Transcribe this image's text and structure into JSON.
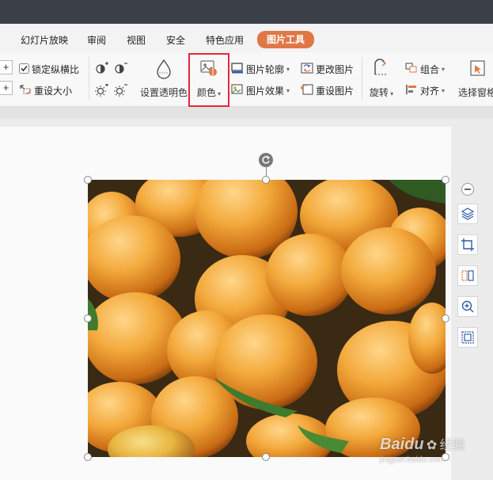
{
  "tabs": [
    {
      "label": "幻灯片放映"
    },
    {
      "label": "审阅"
    },
    {
      "label": "视图"
    },
    {
      "label": "安全"
    },
    {
      "label": "特色应用"
    },
    {
      "label": "图片工具"
    }
  ],
  "ribbon": {
    "lock_ratio": "锁定纵横比",
    "reset_size": "重设大小",
    "set_transparent": "设置透明色",
    "color": "颜色",
    "pic_outline": "图片轮廓",
    "pic_effect": "图片效果",
    "change_pic": "更改图片",
    "reset_pic": "重设图片",
    "rotate": "旋转",
    "group": "组合",
    "align": "对齐",
    "select_pane": "选择窗格"
  },
  "watermark": {
    "brand": "Baidu",
    "suffix": "经验",
    "url": "jingyan.baidu.com"
  },
  "colors": {
    "accent": "#e07747",
    "highlight": "#e02a3a",
    "titlebar": "#3c4049"
  }
}
